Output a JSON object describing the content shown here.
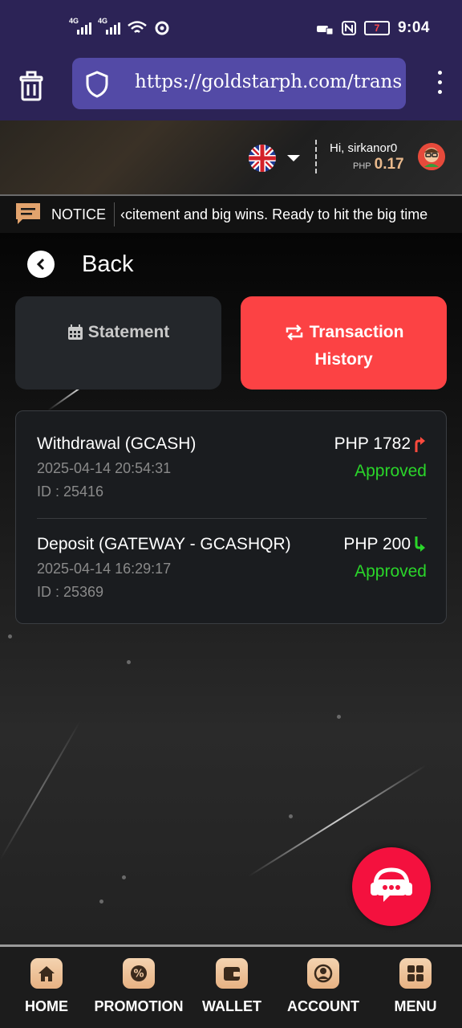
{
  "status_bar": {
    "signal_1_label": "4G",
    "signal_2_label": "4G",
    "battery": "7",
    "time": "9:04"
  },
  "browser": {
    "url": "https://goldstarph.com/trans"
  },
  "header": {
    "greeting": "Hi, sirkanor0",
    "currency": "PHP",
    "balance": "0.17"
  },
  "notice": {
    "label": "NOTICE",
    "text": "‹citement and big wins. Ready to hit the big time"
  },
  "nav": {
    "back_label": "Back"
  },
  "tabs": {
    "statement_label": "Statement",
    "history_line1": "Transaction",
    "history_line2": "History"
  },
  "transactions": [
    {
      "title": "Withdrawal (GCASH)",
      "date": "2025-04-14 20:54:31",
      "id": "ID : 25416",
      "amount": "PHP 1782",
      "status": "Approved",
      "direction": "up"
    },
    {
      "title": "Deposit (GATEWAY - GCASHQR)",
      "date": "2025-04-14 16:29:17",
      "id": "ID : 25369",
      "amount": "PHP 200",
      "status": "Approved",
      "direction": "down"
    }
  ],
  "bottom_nav": {
    "home": "HOME",
    "promotion": "PROMOTION",
    "wallet": "WALLET",
    "account": "ACCOUNT",
    "menu": "MENU"
  },
  "colors": {
    "accent_red": "#fc4244",
    "approved_green": "#2ad62a",
    "balance_gold": "#e9b98c",
    "browser_purple": "#2c2356"
  }
}
